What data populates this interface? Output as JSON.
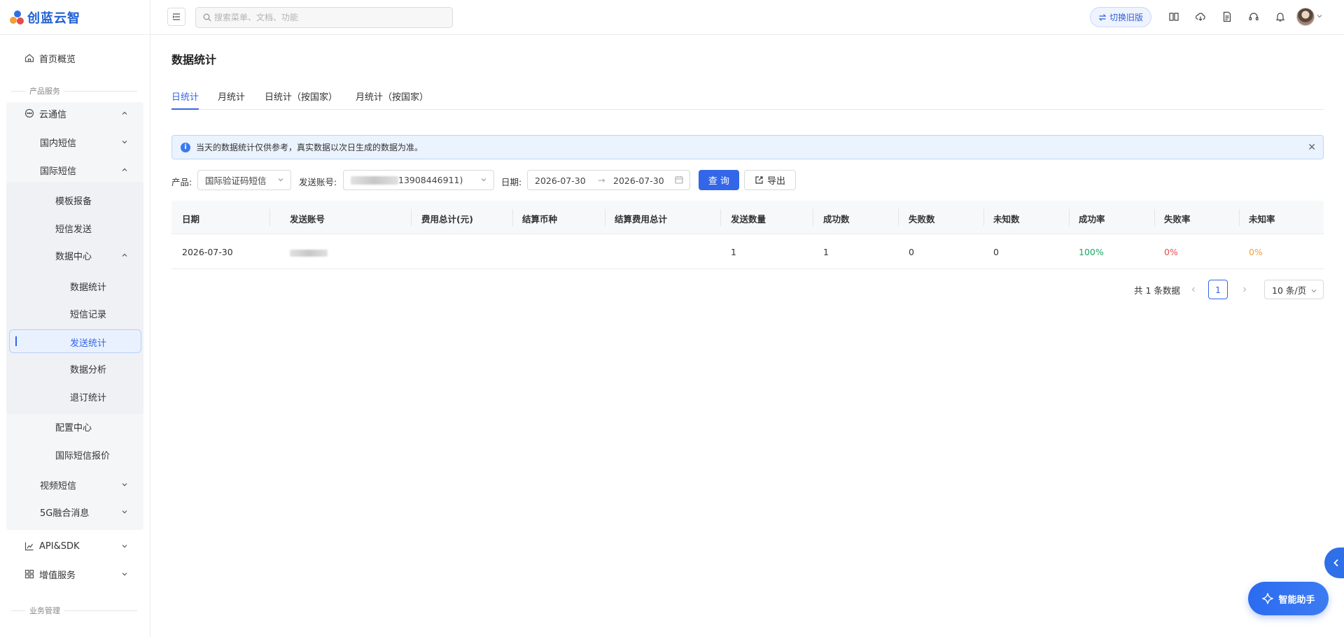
{
  "app": {
    "logo_text": "创蓝云智"
  },
  "sidebar": {
    "home": "首页概览",
    "section_product": "产品服务",
    "cloud_comm": "云通信",
    "domestic_sms": "国内短信",
    "intl_sms": "国际短信",
    "template_report": "模板报备",
    "sms_send": "短信发送",
    "data_center": "数据中心",
    "data_stats": "数据统计",
    "sms_records": "短信记录",
    "send_stats": "发送统计",
    "data_analysis": "数据分析",
    "unsubscribe_stats": "退订统计",
    "config_center": "配置中心",
    "intl_sms_price": "国际短信报价",
    "video_sms": "视频短信",
    "five_g": "5G融合消息",
    "api_sdk": "API&SDK",
    "value_added": "增值服务",
    "section_business": "业务管理"
  },
  "header": {
    "search_placeholder": "搜索菜单、文档、功能",
    "switch_label": "切换旧版",
    "icons": [
      "book-icon",
      "cloud-download-icon",
      "document-icon",
      "headset-icon",
      "bell-icon"
    ]
  },
  "main": {
    "title": "数据统计",
    "tabs": [
      "日统计",
      "月统计",
      "日统计（按国家）",
      "月统计（按国家）"
    ],
    "alert": "当天的数据统计仅供参考，真实数据以次日生成的数据为准。",
    "filters": {
      "product_label": "产品:",
      "product_value": "国际验证码短信",
      "account_label": "发送账号:",
      "account_value": "13908446911)",
      "date_label": "日期:",
      "date_start": "2026-07-30",
      "date_end": "2026-07-30",
      "query_btn": "查 询",
      "export_btn": "导出"
    },
    "table": {
      "headers": [
        "日期",
        "发送账号",
        "费用总计(元)",
        "结算币种",
        "结算费用总计",
        "发送数量",
        "成功数",
        "失败数",
        "未知数",
        "成功率",
        "失败率",
        "未知率"
      ],
      "rows": [
        {
          "date": "2026-07-30",
          "account": "",
          "cost": "",
          "currency": "",
          "settle": "",
          "sent": "1",
          "success": "1",
          "fail": "0",
          "unknown": "0",
          "success_rate": "100%",
          "fail_rate": "0%",
          "unknown_rate": "0%"
        }
      ]
    },
    "pagination": {
      "total": "共 1 条数据",
      "current": "1",
      "page_size": "10 条/页"
    }
  },
  "assistant": {
    "label": "智能助手"
  },
  "colors": {
    "primary": "#3366e8",
    "success": "#19a563",
    "danger": "#e84b4b",
    "warning": "#f0a03b"
  }
}
